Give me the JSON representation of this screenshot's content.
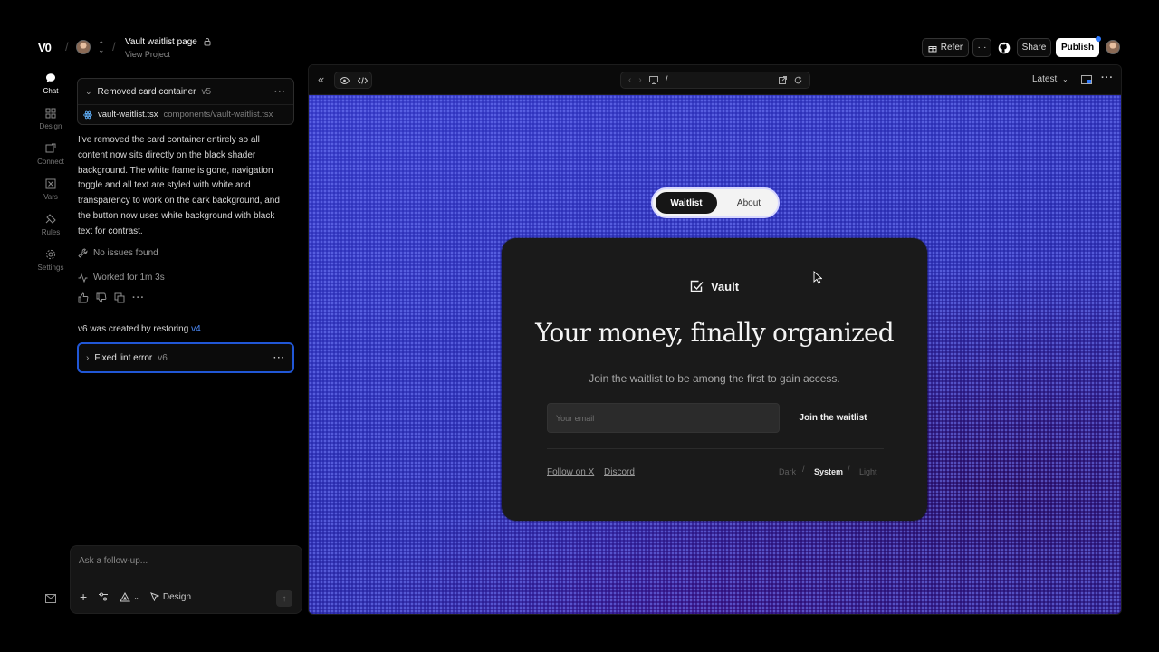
{
  "app": {
    "logo": "V0",
    "project_title": "Vault waitlist page",
    "project_sub": "View Project"
  },
  "toolbar": {
    "refer_label": "Refer",
    "more_label": "···",
    "share_label": "Share",
    "publish_label": "Publish"
  },
  "rail": {
    "items": [
      {
        "label": "Chat",
        "icon": "chat-icon"
      },
      {
        "label": "Design",
        "icon": "design-icon"
      },
      {
        "label": "Connect",
        "icon": "connect-icon"
      },
      {
        "label": "Vars",
        "icon": "vars-icon"
      },
      {
        "label": "Rules",
        "icon": "rules-icon"
      },
      {
        "label": "Settings",
        "icon": "gear-icon"
      }
    ]
  },
  "chat": {
    "card1": {
      "title": "Removed card container",
      "version": "v5",
      "file_name": "vault-waitlist.tsx",
      "file_path": "components/vault-waitlist.tsx"
    },
    "message": "I've removed the card container entirely so all content now sits directly on the black shader background. The white frame is gone, navigation toggle and all text are styled with white and transparency to work on the dark background, and the button now uses white background with black text for contrast.",
    "no_issues": "No issues found",
    "worked_for": "Worked for 1m 3s",
    "restored_text": "v6 was created by restoring",
    "restored_link": "v4",
    "card2": {
      "title": "Fixed lint error",
      "version": "v6"
    },
    "composer_placeholder": "Ask a follow-up...",
    "design_label": "Design"
  },
  "preview": {
    "url": "/",
    "version_select": "Latest",
    "toggle": {
      "active": "Waitlist",
      "other": "About"
    },
    "brand": "Vault",
    "headline": "Your money, finally organized",
    "subtitle": "Join the waitlist to be among the first to gain access.",
    "email_placeholder": "Your email",
    "join_label": "Join the waitlist",
    "links": [
      "Follow on X",
      "Discord"
    ],
    "themes": [
      "Dark",
      "System",
      "Light"
    ],
    "theme_selected": "System"
  },
  "colors": {
    "accent_blue": "#2157d6",
    "link_blue": "#4d8dff",
    "canvas_blue": "#2b2aa8"
  }
}
